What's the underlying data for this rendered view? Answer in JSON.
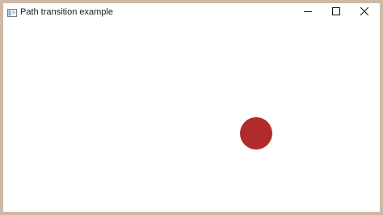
{
  "window": {
    "title": "Path transition example",
    "border_color": "#cdb9a6"
  },
  "titlebar": {
    "app_icon": "window-app-icon",
    "controls": [
      {
        "name": "minimize",
        "icon": "minimize-icon"
      },
      {
        "name": "maximize",
        "icon": "maximize-icon"
      },
      {
        "name": "close",
        "icon": "close-icon"
      }
    ]
  },
  "scene": {
    "ball_color": "#b22b2b",
    "ball_shape": "circle"
  }
}
